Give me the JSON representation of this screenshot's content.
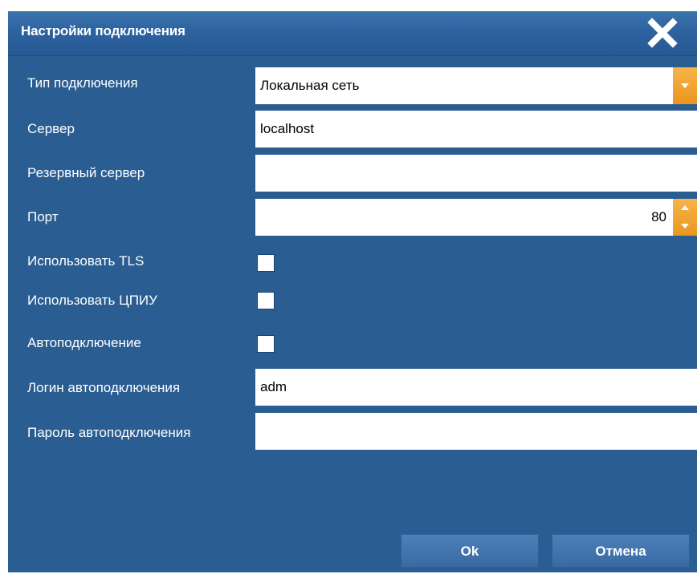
{
  "dialog": {
    "title": "Настройки подключения"
  },
  "fields": {
    "connection_type": {
      "label": "Тип подключения",
      "value": "Локальная сеть"
    },
    "server": {
      "label": "Сервер",
      "value": "localhost"
    },
    "backup_server": {
      "label": "Резервный сервер",
      "value": ""
    },
    "port": {
      "label": "Порт",
      "value": "80"
    },
    "use_tls": {
      "label": "Использовать TLS",
      "checked": false
    },
    "use_cpiu": {
      "label": "Использовать ЦПИУ",
      "checked": false
    },
    "autoconnect": {
      "label": "Автоподключение",
      "checked": false
    },
    "autoconnect_login": {
      "label": "Логин автоподключения",
      "value": "adm"
    },
    "autoconnect_password": {
      "label": "Пароль автоподключения",
      "value": ""
    }
  },
  "buttons": {
    "ok_label": "Ok",
    "cancel_label": "Отмена"
  },
  "colors": {
    "panel_bg": "#2a5d92",
    "accent_orange": "#ea961e",
    "button_bg": "#3a6aa3"
  },
  "icons": {
    "close": "close-icon",
    "dropdown": "chevron-down-icon",
    "spinner_up": "arrow-up-icon",
    "spinner_down": "arrow-down-icon"
  }
}
